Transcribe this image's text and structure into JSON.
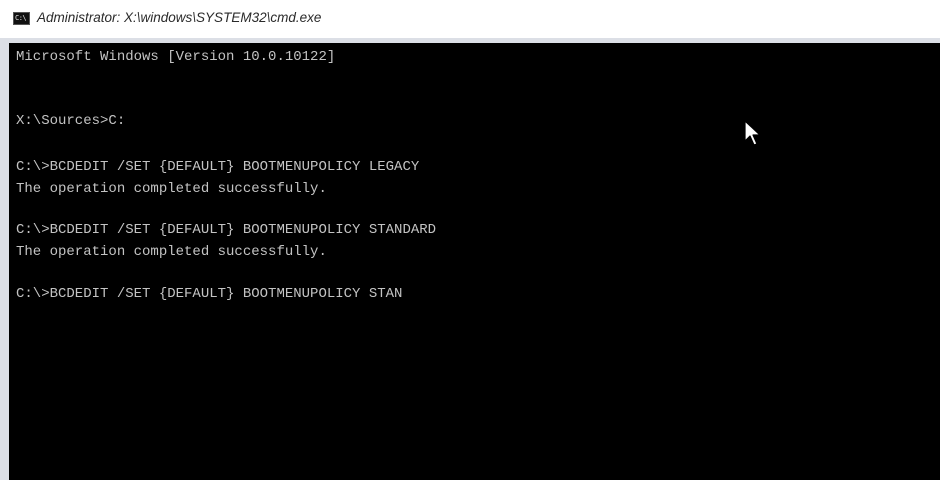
{
  "window": {
    "title": "Administrator: X:\\windows\\SYSTEM32\\cmd.exe",
    "icon": "cmd-icon",
    "icon_glyph": "C:\\"
  },
  "console": {
    "background": "#000000",
    "foreground": "#c3c3c3",
    "lines": [
      "Microsoft Windows [Version 10.0.10122]",
      "X:\\Sources>C:",
      "C:\\>BCDEDIT /SET {DEFAULT} BOOTMENUPOLICY LEGACY",
      "The operation completed successfully.",
      "C:\\>BCDEDIT /SET {DEFAULT} BOOTMENUPOLICY STANDARD",
      "The operation completed successfully.",
      "C:\\>BCDEDIT /SET {DEFAULT} BOOTMENUPOLICY STAN"
    ]
  },
  "pointer": {
    "icon": "mouse-pointer-icon"
  }
}
